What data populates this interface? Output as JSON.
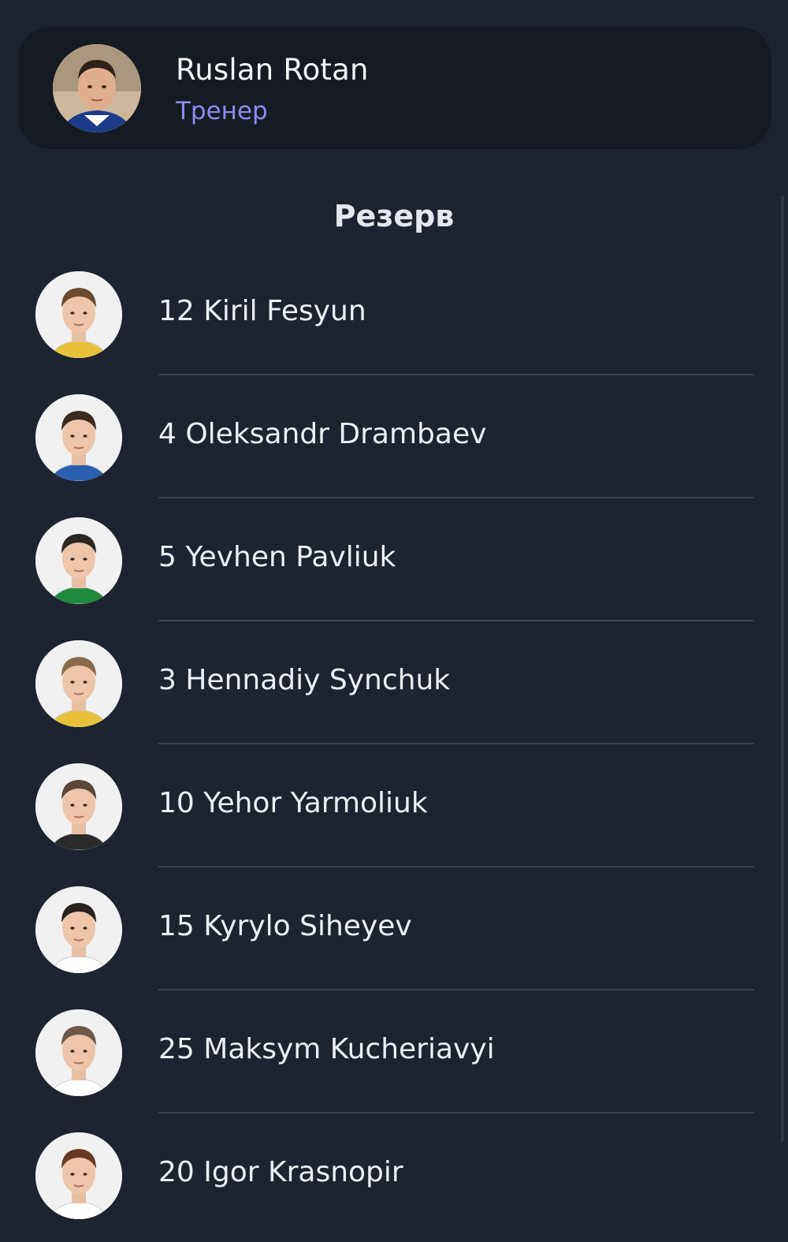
{
  "coach": {
    "name": "Ruslan Rotan",
    "role": "Тренер",
    "avatar_icon": "coach-photo-icon"
  },
  "section": {
    "title": "Резерв"
  },
  "players": [
    {
      "label": "12 Kiril Fesyun",
      "shirt": "#e8c13a",
      "hair": "#6b4a2e"
    },
    {
      "label": "4 Oleksandr Drambaev",
      "shirt": "#2a5fb0",
      "hair": "#3b2a1e"
    },
    {
      "label": "5 Yevhen Pavliuk",
      "shirt": "#1f8a3e",
      "hair": "#2a2622"
    },
    {
      "label": "3 Hennadiy Synchuk",
      "shirt": "#e8c13a",
      "hair": "#8a6a4a"
    },
    {
      "label": "10 Yehor Yarmoliuk",
      "shirt": "#2a2a2a",
      "hair": "#5a4636"
    },
    {
      "label": "15 Kyrylo Siheyev",
      "shirt": "#ffffff",
      "hair": "#2a2320"
    },
    {
      "label": "25 Maksym Kucheriavyi",
      "shirt": "#ffffff",
      "hair": "#6b5848"
    },
    {
      "label": "20 Igor Krasnopir",
      "shirt": "#ffffff",
      "hair": "#6a3a22"
    }
  ],
  "colors": {
    "background": "#1d2430",
    "card": "#161b23",
    "accent": "#8c8cf3",
    "divider": "#3a414d"
  }
}
